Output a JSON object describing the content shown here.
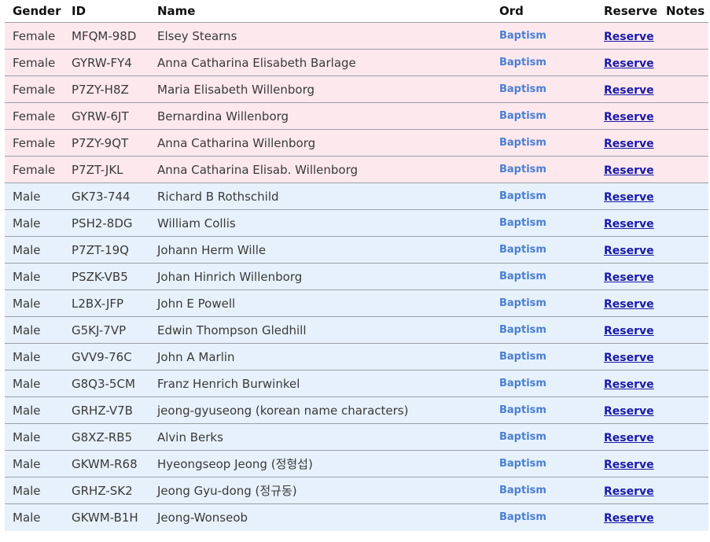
{
  "headers": {
    "gender": "Gender",
    "id": "ID",
    "name": "Name",
    "ord": "Ord",
    "reserve": "Reserve",
    "notes": "Notes"
  },
  "colors": {
    "female_row": "#fde8ee",
    "male_row": "#e6f1fb",
    "ord_text": "#4a7fd0",
    "reserve_link": "#1a1aa6"
  },
  "rows": [
    {
      "gender": "Female",
      "id": "MFQM-98D",
      "name": "Elsey Stearns",
      "ord": "Baptism",
      "reserve": "Reserve",
      "notes": ""
    },
    {
      "gender": "Female",
      "id": "GYRW-FY4",
      "name": "Anna Catharina Elisabeth Barlage",
      "ord": "Baptism",
      "reserve": "Reserve",
      "notes": ""
    },
    {
      "gender": "Female",
      "id": "P7ZY-H8Z",
      "name": "Maria Elisabeth Willenborg",
      "ord": "Baptism",
      "reserve": "Reserve",
      "notes": ""
    },
    {
      "gender": "Female",
      "id": "GYRW-6JT",
      "name": "Bernardina Willenborg",
      "ord": "Baptism",
      "reserve": "Reserve",
      "notes": ""
    },
    {
      "gender": "Female",
      "id": "P7ZY-9QT",
      "name": "Anna Catharina Willenborg",
      "ord": "Baptism",
      "reserve": "Reserve",
      "notes": ""
    },
    {
      "gender": "Female",
      "id": "P7ZT-JKL",
      "name": "Anna Catharina Elisab. Willenborg",
      "ord": "Baptism",
      "reserve": "Reserve",
      "notes": ""
    },
    {
      "gender": "Male",
      "id": "GK73-744",
      "name": "Richard B Rothschild",
      "ord": "Baptism",
      "reserve": "Reserve",
      "notes": ""
    },
    {
      "gender": "Male",
      "id": "PSH2-8DG",
      "name": "William Collis",
      "ord": "Baptism",
      "reserve": "Reserve",
      "notes": ""
    },
    {
      "gender": "Male",
      "id": "P7ZT-19Q",
      "name": "Johann Herm Wille",
      "ord": "Baptism",
      "reserve": "Reserve",
      "notes": ""
    },
    {
      "gender": "Male",
      "id": "PSZK-VB5",
      "name": "Johan Hinrich Willenborg",
      "ord": "Baptism",
      "reserve": "Reserve",
      "notes": ""
    },
    {
      "gender": "Male",
      "id": "L2BX-JFP",
      "name": "John E Powell",
      "ord": "Baptism",
      "reserve": "Reserve",
      "notes": ""
    },
    {
      "gender": "Male",
      "id": "G5KJ-7VP",
      "name": "Edwin Thompson Gledhill",
      "ord": "Baptism",
      "reserve": "Reserve",
      "notes": ""
    },
    {
      "gender": "Male",
      "id": "GVV9-76C",
      "name": "John A Marlin",
      "ord": "Baptism",
      "reserve": "Reserve",
      "notes": ""
    },
    {
      "gender": "Male",
      "id": "G8Q3-5CM",
      "name": "Franz Henrich Burwinkel",
      "ord": "Baptism",
      "reserve": "Reserve",
      "notes": ""
    },
    {
      "gender": "Male",
      "id": "GRHZ-V7B",
      "name": "jeong-gyuseong (korean name characters)",
      "ord": "Baptism",
      "reserve": "Reserve",
      "notes": ""
    },
    {
      "gender": "Male",
      "id": "G8XZ-RB5",
      "name": "Alvin Berks",
      "ord": "Baptism",
      "reserve": "Reserve",
      "notes": ""
    },
    {
      "gender": "Male",
      "id": "GKWM-R68",
      "name": "Hyeongseop Jeong (정형섭)",
      "ord": "Baptism",
      "reserve": "Reserve",
      "notes": ""
    },
    {
      "gender": "Male",
      "id": "GRHZ-SK2",
      "name": "Jeong Gyu-dong (정규동)",
      "ord": "Baptism",
      "reserve": "Reserve",
      "notes": ""
    },
    {
      "gender": "Male",
      "id": "GKWM-B1H",
      "name": "Jeong-Wonseob",
      "ord": "Baptism",
      "reserve": "Reserve",
      "notes": ""
    }
  ]
}
